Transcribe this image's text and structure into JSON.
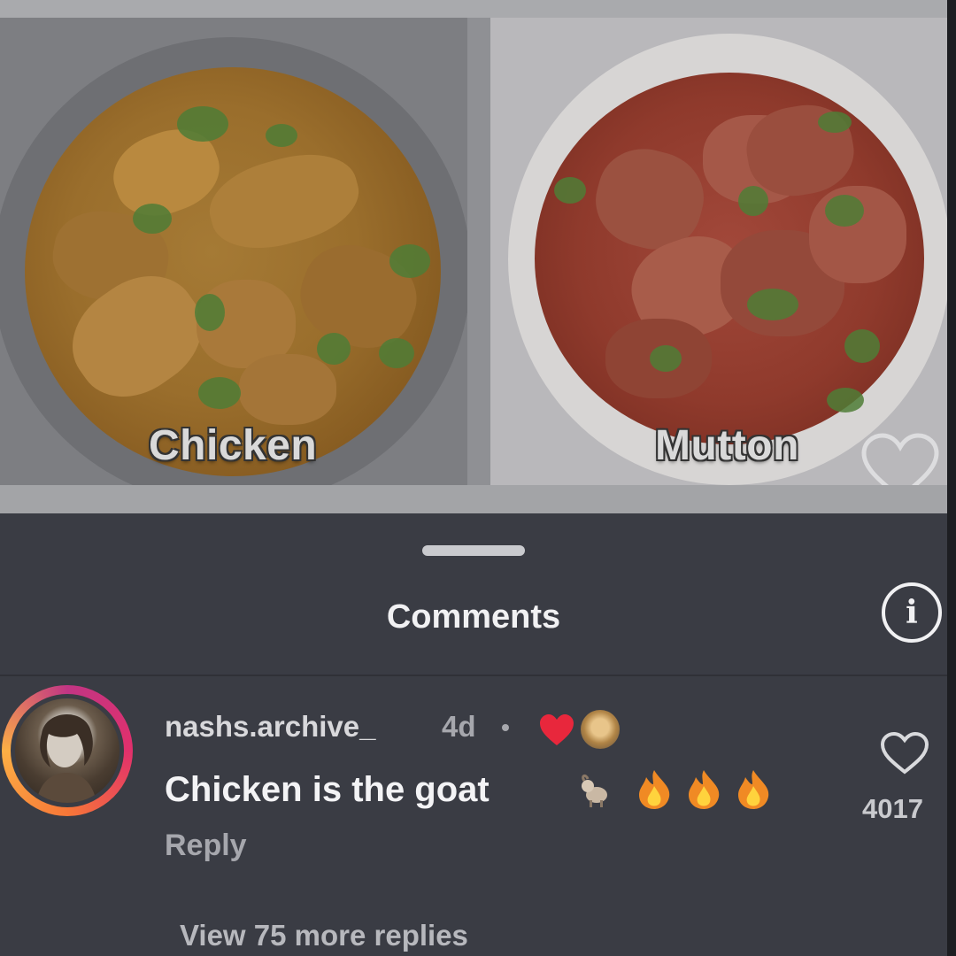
{
  "post": {
    "left_caption": "Chicken",
    "right_caption": "Mutton"
  },
  "comments_sheet": {
    "title": "Comments",
    "info_symbol": "i",
    "comment": {
      "username": "nashs.archive_",
      "time": "4d",
      "text": "Chicken is the goat",
      "emojis": [
        "goat",
        "fire",
        "fire",
        "fire"
      ],
      "reply_label": "Reply",
      "like_count": "4017"
    },
    "view_replies_label": "View 75 more replies"
  },
  "colors": {
    "sheet_background": "#3a3c44",
    "creator_heart": "#e8273c",
    "text_primary": "#f3f3f5",
    "text_secondary": "#a6a7ad"
  }
}
